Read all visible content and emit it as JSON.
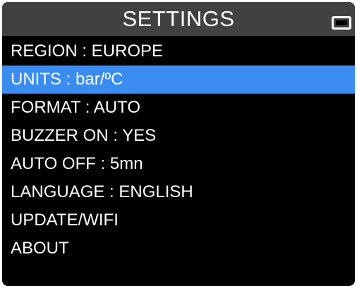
{
  "header": {
    "title": "SETTINGS",
    "battery_icon": "battery-icon"
  },
  "menu": {
    "items": [
      {
        "label": "REGION : EUROPE",
        "selected": false
      },
      {
        "label": "UNITS : bar/ºC",
        "selected": true
      },
      {
        "label": "FORMAT : AUTO",
        "selected": false
      },
      {
        "label": "BUZZER ON : YES",
        "selected": false
      },
      {
        "label": "AUTO OFF : 5mn",
        "selected": false
      },
      {
        "label": "LANGUAGE : ENGLISH",
        "selected": false
      },
      {
        "label": "UPDATE/WIFI",
        "selected": false
      },
      {
        "label": "ABOUT",
        "selected": false
      }
    ]
  },
  "colors": {
    "background": "#000000",
    "header": "#414141",
    "selection": "#3b8cf0",
    "text": "#ffffff"
  }
}
